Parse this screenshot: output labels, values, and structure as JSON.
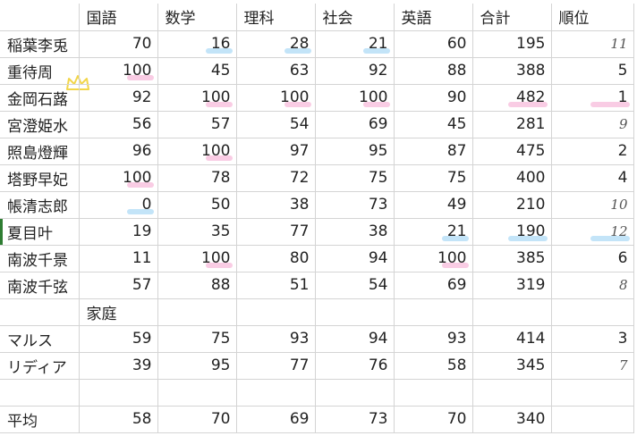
{
  "headers": [
    "",
    "国語",
    "数学",
    "理科",
    "社会",
    "英語",
    "合計",
    "順位"
  ],
  "rows": [
    {
      "name": "稲葉李兎",
      "cells": [
        "70",
        "16",
        "28",
        "21",
        "60",
        "195",
        "11"
      ],
      "hl": [
        "",
        "blue",
        "blue",
        "blue",
        "",
        "",
        ""
      ]
    },
    {
      "name": "重待周",
      "cells": [
        "100",
        "45",
        "63",
        "92",
        "88",
        "388",
        "5"
      ],
      "hl": [
        "pink",
        "",
        "",
        "",
        "",
        "",
        ""
      ]
    },
    {
      "name": "金岡石蕗",
      "cells": [
        "92",
        "100",
        "100",
        "100",
        "90",
        "482",
        "1"
      ],
      "hl": [
        "",
        "pink",
        "pink",
        "pink",
        "",
        "pink",
        "pink"
      ]
    },
    {
      "name": "宮澄姫水",
      "cells": [
        "56",
        "57",
        "54",
        "69",
        "45",
        "281",
        "9"
      ],
      "hl": [
        "",
        "",
        "",
        "",
        "",
        "",
        ""
      ]
    },
    {
      "name": "照島燈輝",
      "cells": [
        "96",
        "100",
        "97",
        "95",
        "87",
        "475",
        "2"
      ],
      "hl": [
        "",
        "pink",
        "",
        "",
        "",
        "",
        ""
      ]
    },
    {
      "name": "塔野早妃",
      "cells": [
        "100",
        "78",
        "72",
        "75",
        "75",
        "400",
        "4"
      ],
      "hl": [
        "pink",
        "",
        "",
        "",
        "",
        "",
        ""
      ]
    },
    {
      "name": "帳清志郎",
      "cells": [
        "0",
        "50",
        "38",
        "73",
        "49",
        "210",
        "10"
      ],
      "hl": [
        "blue",
        "",
        "",
        "",
        "",
        "",
        ""
      ]
    },
    {
      "name": "夏目叶",
      "cells": [
        "19",
        "35",
        "77",
        "38",
        "21",
        "190",
        "12"
      ],
      "hl": [
        "",
        "",
        "",
        "",
        "blue",
        "blue",
        "blue"
      ]
    },
    {
      "name": "南波千景",
      "cells": [
        "11",
        "100",
        "80",
        "94",
        "100",
        "385",
        "6"
      ],
      "hl": [
        "",
        "pink",
        "",
        "",
        "pink",
        "",
        ""
      ]
    },
    {
      "name": "南波千弦",
      "cells": [
        "57",
        "88",
        "51",
        "54",
        "69",
        "319",
        "8"
      ],
      "hl": [
        "",
        "",
        "",
        "",
        "",
        "",
        ""
      ]
    }
  ],
  "section_label": "家庭",
  "rows2": [
    {
      "name": "マルス",
      "cells": [
        "59",
        "75",
        "93",
        "94",
        "93",
        "414",
        "3"
      ]
    },
    {
      "name": "リディア",
      "cells": [
        "39",
        "95",
        "77",
        "76",
        "58",
        "345",
        "7"
      ]
    }
  ],
  "average": {
    "name": "平均",
    "cells": [
      "58",
      "70",
      "69",
      "73",
      "70",
      "340",
      ""
    ]
  },
  "handwritten_rank_rows": [
    0,
    3,
    6,
    7,
    9
  ],
  "colors": {
    "highlight_blue": "#aad8f5",
    "highlight_pink": "#f7b7d8",
    "grid": "#d4d4d4",
    "crown": "#f2d64b"
  },
  "icons": {
    "crown": "crown-icon"
  }
}
